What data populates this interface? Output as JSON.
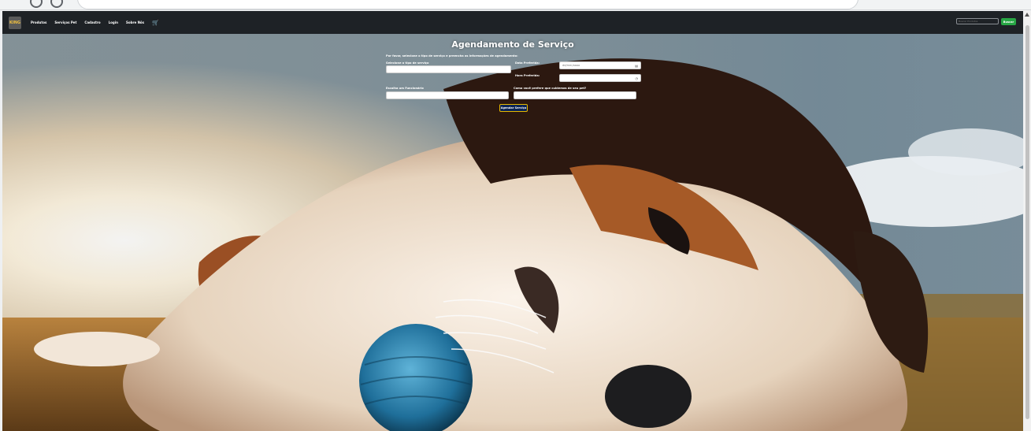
{
  "navbar": {
    "logo_text": "KING",
    "links": [
      "Produtos",
      "Serviços Pet",
      "Cadastro",
      "Login",
      "Sobre Nós"
    ],
    "cart_icon": "cart-icon",
    "search_placeholder": "Buscar Produtos",
    "search_button": "Buscar"
  },
  "form": {
    "title": "Agendamento de Serviço",
    "intro": "Por favor, selecione o tipo de serviço e preencha as informações de agendamento:",
    "service_label": "Selecione o tipo de serviço",
    "date_label": "Data Preferida:",
    "date_placeholder": "dd/mm/aaaa",
    "time_label": "Hora Preferida:",
    "observations_label": "Escolha um Funcionário",
    "care_label": "Como você prefere que cuidemos de seu pet?",
    "submit_label": "Agendar Serviço"
  },
  "colors": {
    "navbar_bg": "#1e2226",
    "search_button": "#28a745",
    "submit_bg": "#0b2454",
    "submit_border": "#e6b800"
  }
}
